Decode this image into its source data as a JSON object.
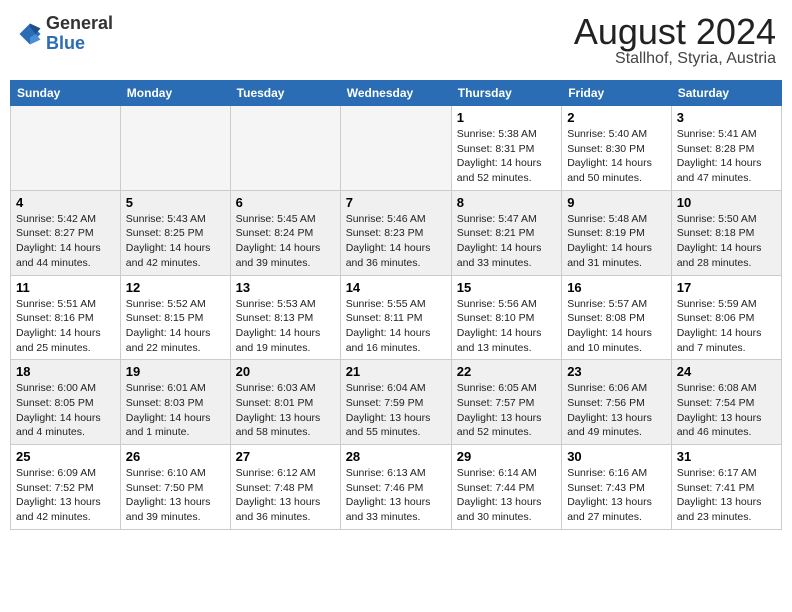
{
  "header": {
    "logo_general": "General",
    "logo_blue": "Blue",
    "month_title": "August 2024",
    "location": "Stallhof, Styria, Austria"
  },
  "weekdays": [
    "Sunday",
    "Monday",
    "Tuesday",
    "Wednesday",
    "Thursday",
    "Friday",
    "Saturday"
  ],
  "weeks": [
    [
      {
        "day": "",
        "info": ""
      },
      {
        "day": "",
        "info": ""
      },
      {
        "day": "",
        "info": ""
      },
      {
        "day": "",
        "info": ""
      },
      {
        "day": "1",
        "info": "Sunrise: 5:38 AM\nSunset: 8:31 PM\nDaylight: 14 hours\nand 52 minutes."
      },
      {
        "day": "2",
        "info": "Sunrise: 5:40 AM\nSunset: 8:30 PM\nDaylight: 14 hours\nand 50 minutes."
      },
      {
        "day": "3",
        "info": "Sunrise: 5:41 AM\nSunset: 8:28 PM\nDaylight: 14 hours\nand 47 minutes."
      }
    ],
    [
      {
        "day": "4",
        "info": "Sunrise: 5:42 AM\nSunset: 8:27 PM\nDaylight: 14 hours\nand 44 minutes."
      },
      {
        "day": "5",
        "info": "Sunrise: 5:43 AM\nSunset: 8:25 PM\nDaylight: 14 hours\nand 42 minutes."
      },
      {
        "day": "6",
        "info": "Sunrise: 5:45 AM\nSunset: 8:24 PM\nDaylight: 14 hours\nand 39 minutes."
      },
      {
        "day": "7",
        "info": "Sunrise: 5:46 AM\nSunset: 8:23 PM\nDaylight: 14 hours\nand 36 minutes."
      },
      {
        "day": "8",
        "info": "Sunrise: 5:47 AM\nSunset: 8:21 PM\nDaylight: 14 hours\nand 33 minutes."
      },
      {
        "day": "9",
        "info": "Sunrise: 5:48 AM\nSunset: 8:19 PM\nDaylight: 14 hours\nand 31 minutes."
      },
      {
        "day": "10",
        "info": "Sunrise: 5:50 AM\nSunset: 8:18 PM\nDaylight: 14 hours\nand 28 minutes."
      }
    ],
    [
      {
        "day": "11",
        "info": "Sunrise: 5:51 AM\nSunset: 8:16 PM\nDaylight: 14 hours\nand 25 minutes."
      },
      {
        "day": "12",
        "info": "Sunrise: 5:52 AM\nSunset: 8:15 PM\nDaylight: 14 hours\nand 22 minutes."
      },
      {
        "day": "13",
        "info": "Sunrise: 5:53 AM\nSunset: 8:13 PM\nDaylight: 14 hours\nand 19 minutes."
      },
      {
        "day": "14",
        "info": "Sunrise: 5:55 AM\nSunset: 8:11 PM\nDaylight: 14 hours\nand 16 minutes."
      },
      {
        "day": "15",
        "info": "Sunrise: 5:56 AM\nSunset: 8:10 PM\nDaylight: 14 hours\nand 13 minutes."
      },
      {
        "day": "16",
        "info": "Sunrise: 5:57 AM\nSunset: 8:08 PM\nDaylight: 14 hours\nand 10 minutes."
      },
      {
        "day": "17",
        "info": "Sunrise: 5:59 AM\nSunset: 8:06 PM\nDaylight: 14 hours\nand 7 minutes."
      }
    ],
    [
      {
        "day": "18",
        "info": "Sunrise: 6:00 AM\nSunset: 8:05 PM\nDaylight: 14 hours\nand 4 minutes."
      },
      {
        "day": "19",
        "info": "Sunrise: 6:01 AM\nSunset: 8:03 PM\nDaylight: 14 hours\nand 1 minute."
      },
      {
        "day": "20",
        "info": "Sunrise: 6:03 AM\nSunset: 8:01 PM\nDaylight: 13 hours\nand 58 minutes."
      },
      {
        "day": "21",
        "info": "Sunrise: 6:04 AM\nSunset: 7:59 PM\nDaylight: 13 hours\nand 55 minutes."
      },
      {
        "day": "22",
        "info": "Sunrise: 6:05 AM\nSunset: 7:57 PM\nDaylight: 13 hours\nand 52 minutes."
      },
      {
        "day": "23",
        "info": "Sunrise: 6:06 AM\nSunset: 7:56 PM\nDaylight: 13 hours\nand 49 minutes."
      },
      {
        "day": "24",
        "info": "Sunrise: 6:08 AM\nSunset: 7:54 PM\nDaylight: 13 hours\nand 46 minutes."
      }
    ],
    [
      {
        "day": "25",
        "info": "Sunrise: 6:09 AM\nSunset: 7:52 PM\nDaylight: 13 hours\nand 42 minutes."
      },
      {
        "day": "26",
        "info": "Sunrise: 6:10 AM\nSunset: 7:50 PM\nDaylight: 13 hours\nand 39 minutes."
      },
      {
        "day": "27",
        "info": "Sunrise: 6:12 AM\nSunset: 7:48 PM\nDaylight: 13 hours\nand 36 minutes."
      },
      {
        "day": "28",
        "info": "Sunrise: 6:13 AM\nSunset: 7:46 PM\nDaylight: 13 hours\nand 33 minutes."
      },
      {
        "day": "29",
        "info": "Sunrise: 6:14 AM\nSunset: 7:44 PM\nDaylight: 13 hours\nand 30 minutes."
      },
      {
        "day": "30",
        "info": "Sunrise: 6:16 AM\nSunset: 7:43 PM\nDaylight: 13 hours\nand 27 minutes."
      },
      {
        "day": "31",
        "info": "Sunrise: 6:17 AM\nSunset: 7:41 PM\nDaylight: 13 hours\nand 23 minutes."
      }
    ]
  ]
}
